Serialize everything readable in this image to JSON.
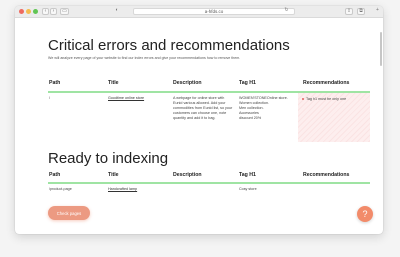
{
  "browser": {
    "url": "a-hfds.co",
    "icons": [
      "back-icon",
      "forward-icon",
      "sidebar-icon",
      "lock-icon",
      "reload-icon",
      "share-icon",
      "tabs-icon"
    ]
  },
  "errors_section": {
    "title": "Critical errors and recommendations",
    "description": "We will analyze every page of your website to find our index errors and give your recommendations how to remove them.",
    "columns": [
      "Path",
      "Title",
      "Description",
      "Tag H1",
      "Recommendations"
    ],
    "rows": [
      {
        "path": "/",
        "title": "Goodtime online store",
        "description": [
          "A webpage for online store with",
          "Eunid various allowed. Add your",
          "commodities from Eunid list, so your",
          "customers can choose one, note",
          "quantity and add it to bag."
        ],
        "h1": [
          "WOMEN'STONEOnline store.",
          "Women collection.",
          "Men collection.",
          "Accessories",
          "discount 20%"
        ],
        "recommendation": "Tag h1 must be only one"
      }
    ]
  },
  "indexing_section": {
    "title": "Ready to indexing",
    "columns": [
      "Path",
      "Title",
      "Description",
      "Tag H1",
      "Recommendations"
    ],
    "rows": [
      {
        "path": "/product-page",
        "title": "Handcrafted lamp",
        "description": "",
        "h1": "Cosy store",
        "recommendation": ""
      }
    ]
  },
  "cta_label": "Check pages",
  "help_label": "?",
  "colors": {
    "accent": "#ec9a82",
    "help": "#f28b6a",
    "header_rule": "#9fe4a3",
    "error_highlight": "#fdeeee"
  }
}
